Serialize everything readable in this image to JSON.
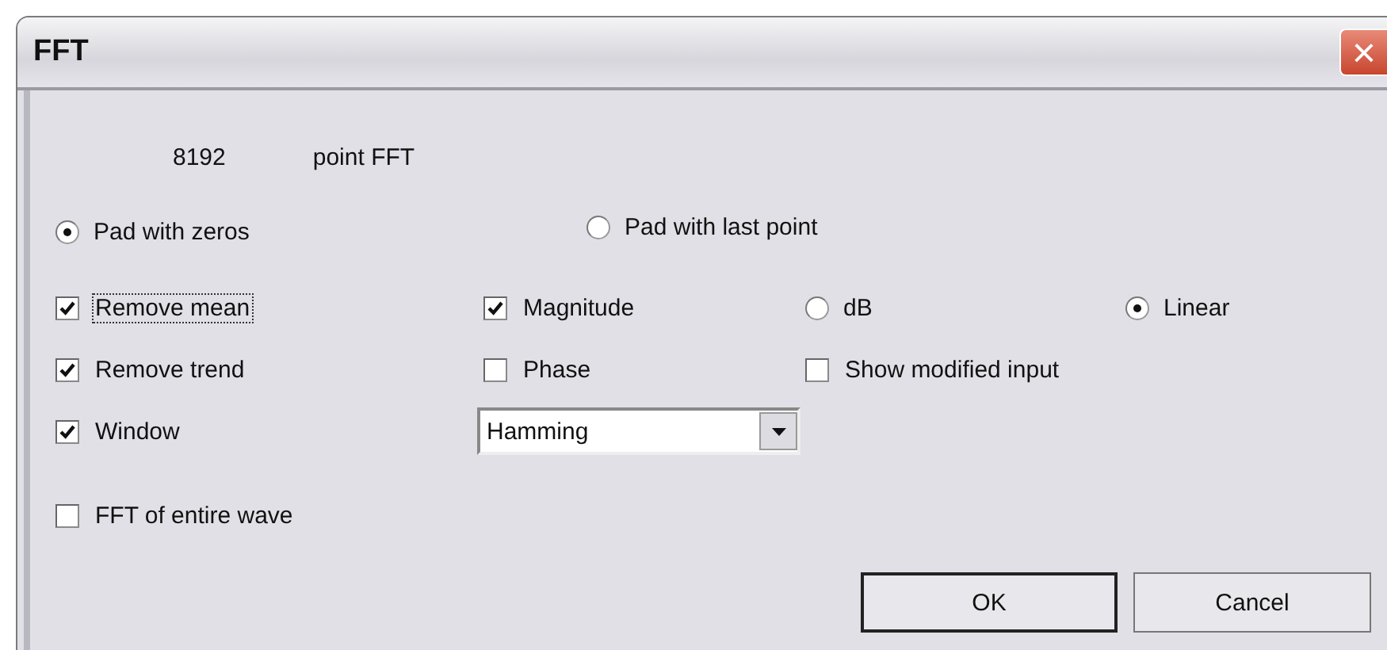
{
  "window": {
    "title": "FFT",
    "close": "×"
  },
  "fft_size": {
    "value": "8192",
    "label": "point FFT"
  },
  "padding": [
    {
      "label": "Pad with zeros",
      "selected": true
    },
    {
      "label": "Pad with last point",
      "selected": false
    }
  ],
  "option_rows": [
    [
      {
        "kind": "checkbox",
        "label": "Remove mean",
        "checked": true,
        "focused": true
      },
      {
        "kind": "checkbox",
        "label": "Magnitude",
        "checked": true,
        "focused": false
      },
      {
        "kind": "radio",
        "label": "dB",
        "selected": false
      },
      {
        "kind": "radio",
        "label": "Linear",
        "selected": true
      }
    ],
    [
      {
        "kind": "checkbox",
        "label": "Remove trend",
        "checked": true,
        "focused": false
      },
      {
        "kind": "checkbox",
        "label": "Phase",
        "checked": false,
        "focused": false
      },
      {
        "kind": "checkbox",
        "label": "Show modified input",
        "checked": false,
        "focused": false
      }
    ],
    [
      {
        "kind": "checkbox",
        "label": "Window",
        "checked": true,
        "focused": false
      },
      {
        "kind": "dropdown",
        "value": "Hamming"
      }
    ]
  ],
  "entire_wave": {
    "label": "FFT of entire wave",
    "checked": false
  },
  "buttons": [
    {
      "label": "OK",
      "default": true
    },
    {
      "label": "Cancel",
      "default": false
    }
  ]
}
